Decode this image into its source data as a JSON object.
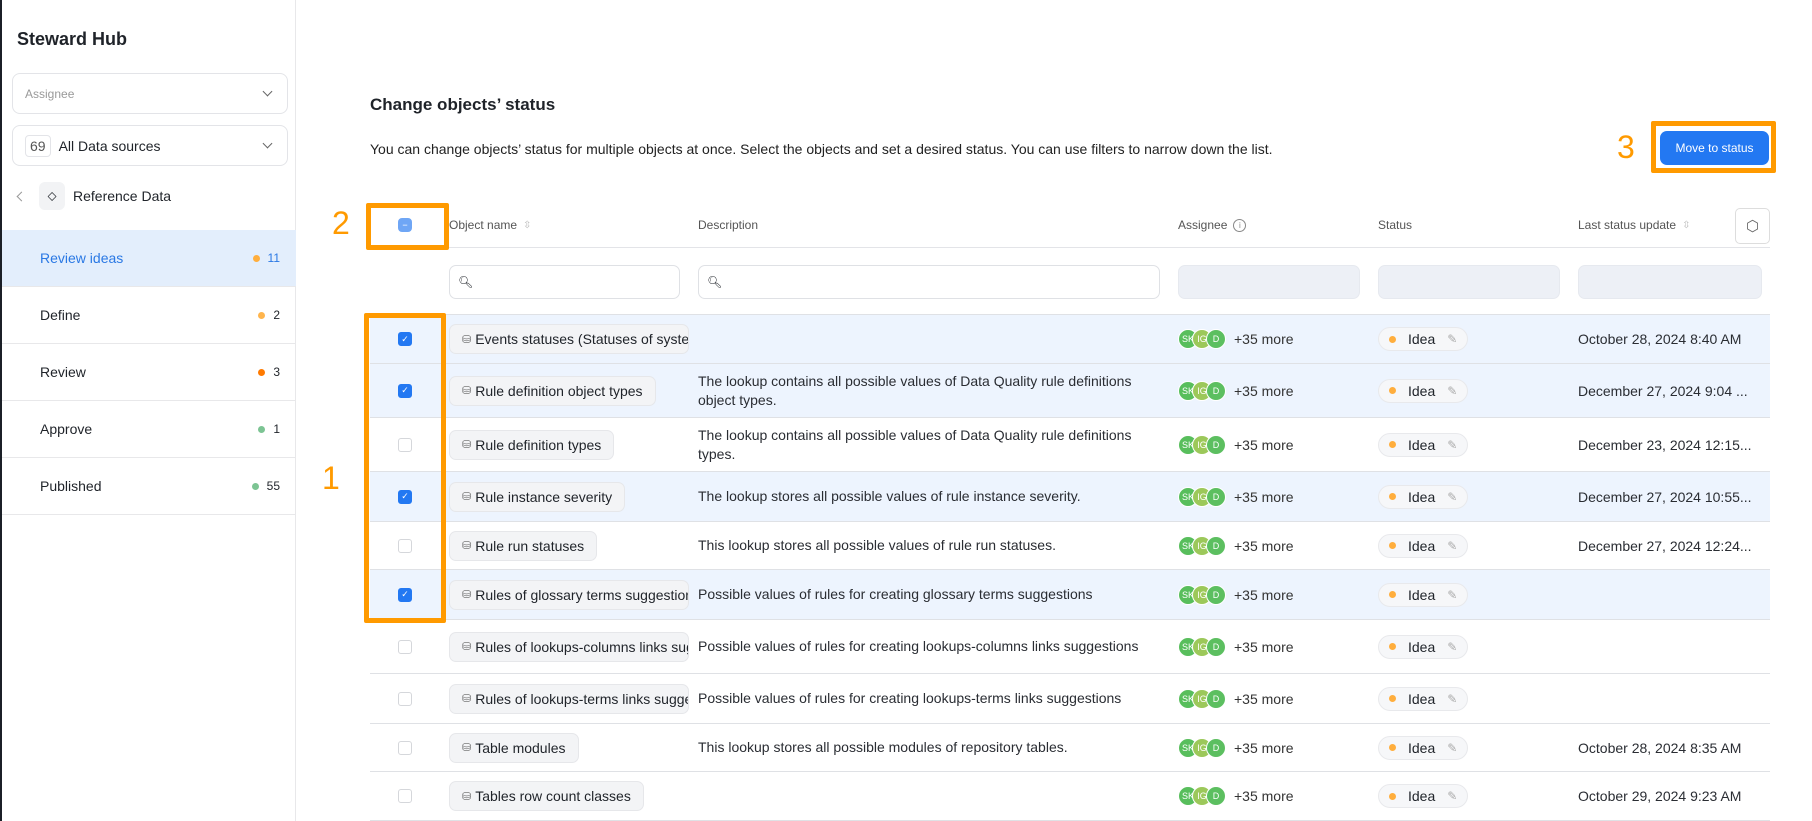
{
  "sidebar": {
    "title": "Steward Hub",
    "assignee_placeholder": "Assignee",
    "datasource_count": "69",
    "datasource_label": "All Data sources",
    "section": "Reference Data",
    "items": [
      {
        "label": "Review ideas",
        "count": "11",
        "color": "#ffae3d",
        "active": true
      },
      {
        "label": "Define",
        "count": "2",
        "color": "#ffb54d"
      },
      {
        "label": "Review",
        "count": "3",
        "color": "#ff7a00"
      },
      {
        "label": "Approve",
        "count": "1",
        "color": "#7cc493"
      },
      {
        "label": "Published",
        "count": "55",
        "color": "#7cc493"
      }
    ]
  },
  "main": {
    "title": "Change objects’ status",
    "description": "You can change objects’ status for multiple objects at once. Select the objects and set a desired status. You can use filters to narrow down the list.",
    "move_button": "Move to status"
  },
  "annotations": {
    "one": "1",
    "two": "2",
    "three": "3"
  },
  "table": {
    "headers": {
      "name": "Object name",
      "description": "Description",
      "assignee": "Assignee",
      "status": "Status",
      "last_update": "Last status update"
    },
    "rows": [
      {
        "checked": true,
        "name": "Events statuses (Statuses of system events)",
        "description": "",
        "more": "+35 more",
        "status": "Idea",
        "date": "October 28, 2024 8:40 AM"
      },
      {
        "checked": true,
        "name": "Rule definition object types",
        "description": "The lookup contains all possible values of Data Quality rule definitions object types.",
        "more": "+35 more",
        "status": "Idea",
        "date": "December 27, 2024 9:04 ..."
      },
      {
        "checked": false,
        "name": "Rule definition types",
        "description": "The lookup contains all possible values of Data Quality rule definitions types.",
        "more": "+35 more",
        "status": "Idea",
        "date": "December 23, 2024 12:15..."
      },
      {
        "checked": true,
        "name": "Rule instance severity",
        "description": "The lookup stores all possible values of rule instance severity.",
        "more": "+35 more",
        "status": "Idea",
        "date": "December 27, 2024 10:55..."
      },
      {
        "checked": false,
        "name": "Rule run statuses",
        "description": "This lookup stores all possible values of rule run statuses.",
        "more": "+35 more",
        "status": "Idea",
        "date": "December 27, 2024 12:24..."
      },
      {
        "checked": true,
        "name": "Rules of glossary terms suggestions",
        "description": "Possible values of rules for creating glossary terms suggestions",
        "more": "+35 more",
        "status": "Idea",
        "date": ""
      },
      {
        "checked": false,
        "name": "Rules of lookups-columns links suggestions",
        "description": "Possible values of rules for creating lookups-columns links suggestions",
        "more": "+35 more",
        "status": "Idea",
        "date": ""
      },
      {
        "checked": false,
        "name": "Rules of lookups-terms links suggestions",
        "description": "Possible values of rules for creating lookups-terms links suggestions",
        "more": "+35 more",
        "status": "Idea",
        "date": ""
      },
      {
        "checked": false,
        "name": "Table modules",
        "description": "This lookup stores all possible modules of repository tables.",
        "more": "+35 more",
        "status": "Idea",
        "date": "October 28, 2024 8:35 AM"
      },
      {
        "checked": false,
        "name": "Tables row count classes",
        "description": "",
        "more": "+35 more",
        "status": "Idea",
        "date": "October 29, 2024 9:23 AM"
      }
    ]
  },
  "avatars": [
    {
      "initials": "SK",
      "color": "#58be5c"
    },
    {
      "initials": "IG",
      "color": "#9cc85a"
    },
    {
      "initials": "D",
      "color": "#5cbf60"
    }
  ],
  "colors": {
    "accent": "#2378f2",
    "highlight": "#ff9a00",
    "status_idea": "#ffae3d"
  }
}
